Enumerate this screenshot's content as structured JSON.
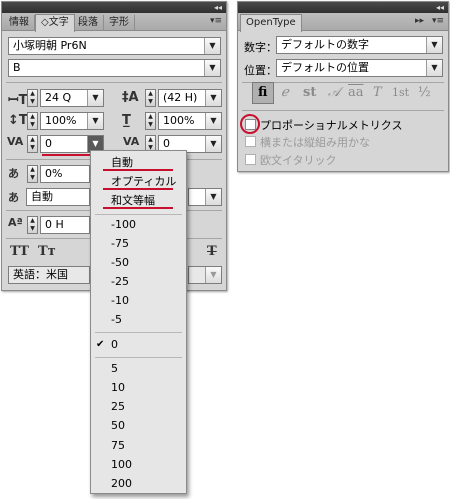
{
  "char_panel": {
    "titlebar_collapse": "◂◂",
    "tabs": [
      "情報",
      "◇文字",
      "段落",
      "字形"
    ],
    "menu_icon": "▾≡",
    "font_family": "小塚明朝 Pr6N",
    "font_style": "B",
    "size": "24 Q",
    "leading": "(42 H)",
    "vertical_scale": "100%",
    "horizontal_scale": "100%",
    "kerning": "0",
    "tracking": "0",
    "tsume": "0%",
    "mojikumi": "自動",
    "baseline_shift": "0 H",
    "caps_buttons": [
      "TT",
      "Tт"
    ],
    "strike_button": "T",
    "language": "英語：米国"
  },
  "kerning_menu": {
    "items_top": [
      "自動",
      "オプティカル",
      "和文等幅"
    ],
    "items_negative": [
      "-100",
      "-75",
      "-50",
      "-25",
      "-10",
      "-5"
    ],
    "item_selected": "0",
    "checkmark": "✔",
    "items_positive": [
      "5",
      "10",
      "25",
      "50",
      "75",
      "100",
      "200"
    ]
  },
  "opentype_panel": {
    "titlebar_collapse": "◂◂",
    "tab": "OpenType",
    "expand_icon": "▸▸",
    "menu_icon": "▾≡",
    "number_label": "数字：",
    "number_value": "デフォルトの数字",
    "position_label": "位置：",
    "position_value": "デフォルトの位置",
    "glyph_buttons": [
      "fi",
      "ℯ",
      "st",
      "𝒜",
      "aa",
      "T",
      "1st",
      "½"
    ],
    "proportional_label": "プロポーショナルメトリクス",
    "vertical_label": "横または縦組み用かな",
    "italic_label": "欧文イタリック"
  },
  "colors": {
    "annotation_red": "#c8102e",
    "panel_bg": "#d6d6d6"
  }
}
